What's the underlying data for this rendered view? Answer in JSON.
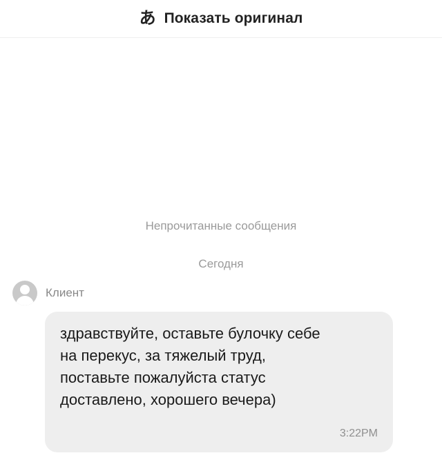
{
  "header": {
    "translate_icon_name": "translate-icon",
    "translate_icon_glyph": "あ",
    "show_original_label": "Показать оригинал"
  },
  "chat": {
    "unread_label": "Непрочитанные сообщения",
    "today_label": "Сегодня",
    "sender": {
      "avatar_icon": "avatar-placeholder-icon",
      "name": "Клиент"
    },
    "message": {
      "lines": [
        "здравствуйте, оставьте булочку себе",
        "на перекус, за тяжелый труд,",
        "поставьте пожалуйста статус",
        "доставлено, хорошего вечера)"
      ],
      "time": "3:22PM"
    }
  },
  "colors": {
    "background": "#ffffff",
    "bubble": "#eeeeee",
    "muted_text": "#9a9a9a",
    "primary_text": "#1a1a1a"
  }
}
